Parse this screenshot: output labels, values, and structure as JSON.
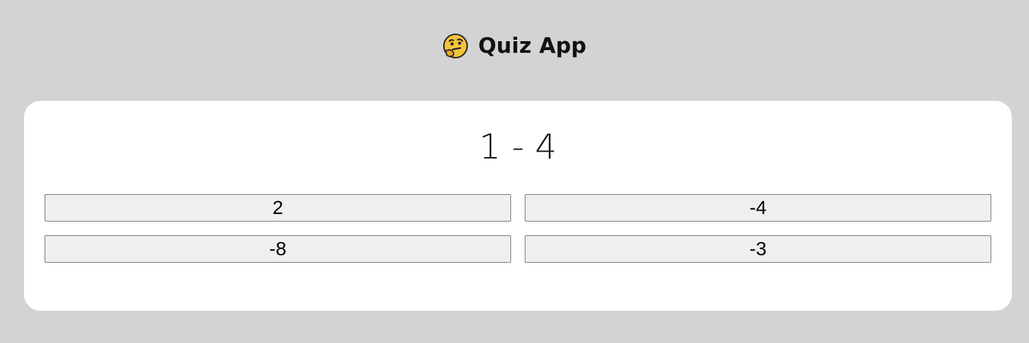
{
  "header": {
    "icon": "thinking-face-icon",
    "title": "Quiz App"
  },
  "quiz": {
    "question": "1 - 4",
    "answers": [
      "2",
      "-4",
      "-8",
      "-3"
    ]
  },
  "colors": {
    "background": "#d3d3d3",
    "card": "#ffffff",
    "button": "#efefef",
    "button_border": "#767676"
  }
}
